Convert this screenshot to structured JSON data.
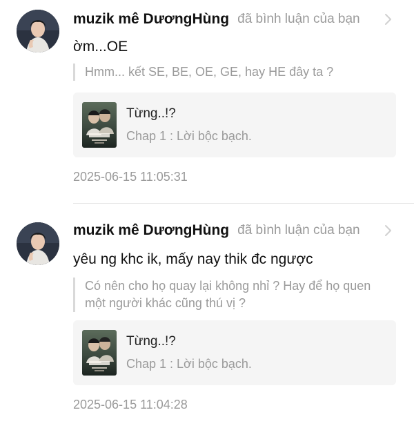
{
  "notifications": [
    {
      "username": "muzik mê DươngHùng",
      "action": "đã bình luận của bạn",
      "comment": "ờm...OE",
      "quote": "Hmm... kết SE, BE, OE, GE, hay HE đây ta ?",
      "story": {
        "title": "Từng..!?",
        "chapter": "Chap 1 : Lời bộc bạch."
      },
      "timestamp": "2025-06-15 11:05:31"
    },
    {
      "username": "muzik mê DươngHùng",
      "action": "đã bình luận của bạn",
      "comment": "yêu ng khc ik, mấy nay thik đc ngược",
      "quote": "Có nên cho họ quay lại không nhỉ ? Hay để họ quen một người khác cũng thú vị ?",
      "story": {
        "title": "Từng..!?",
        "chapter": "Chap 1 : Lời bộc bạch."
      },
      "timestamp": "2025-06-15 11:04:28"
    }
  ],
  "icons": {
    "chevron": "chevron-right-icon",
    "avatar": "avatar",
    "cover": "book-cover"
  },
  "colors": {
    "primary_text": "#111111",
    "secondary_text": "#9a9a9a",
    "card_background": "#f5f5f5",
    "quote_bar": "#d9d9d9",
    "divider": "#e3e3e3"
  }
}
